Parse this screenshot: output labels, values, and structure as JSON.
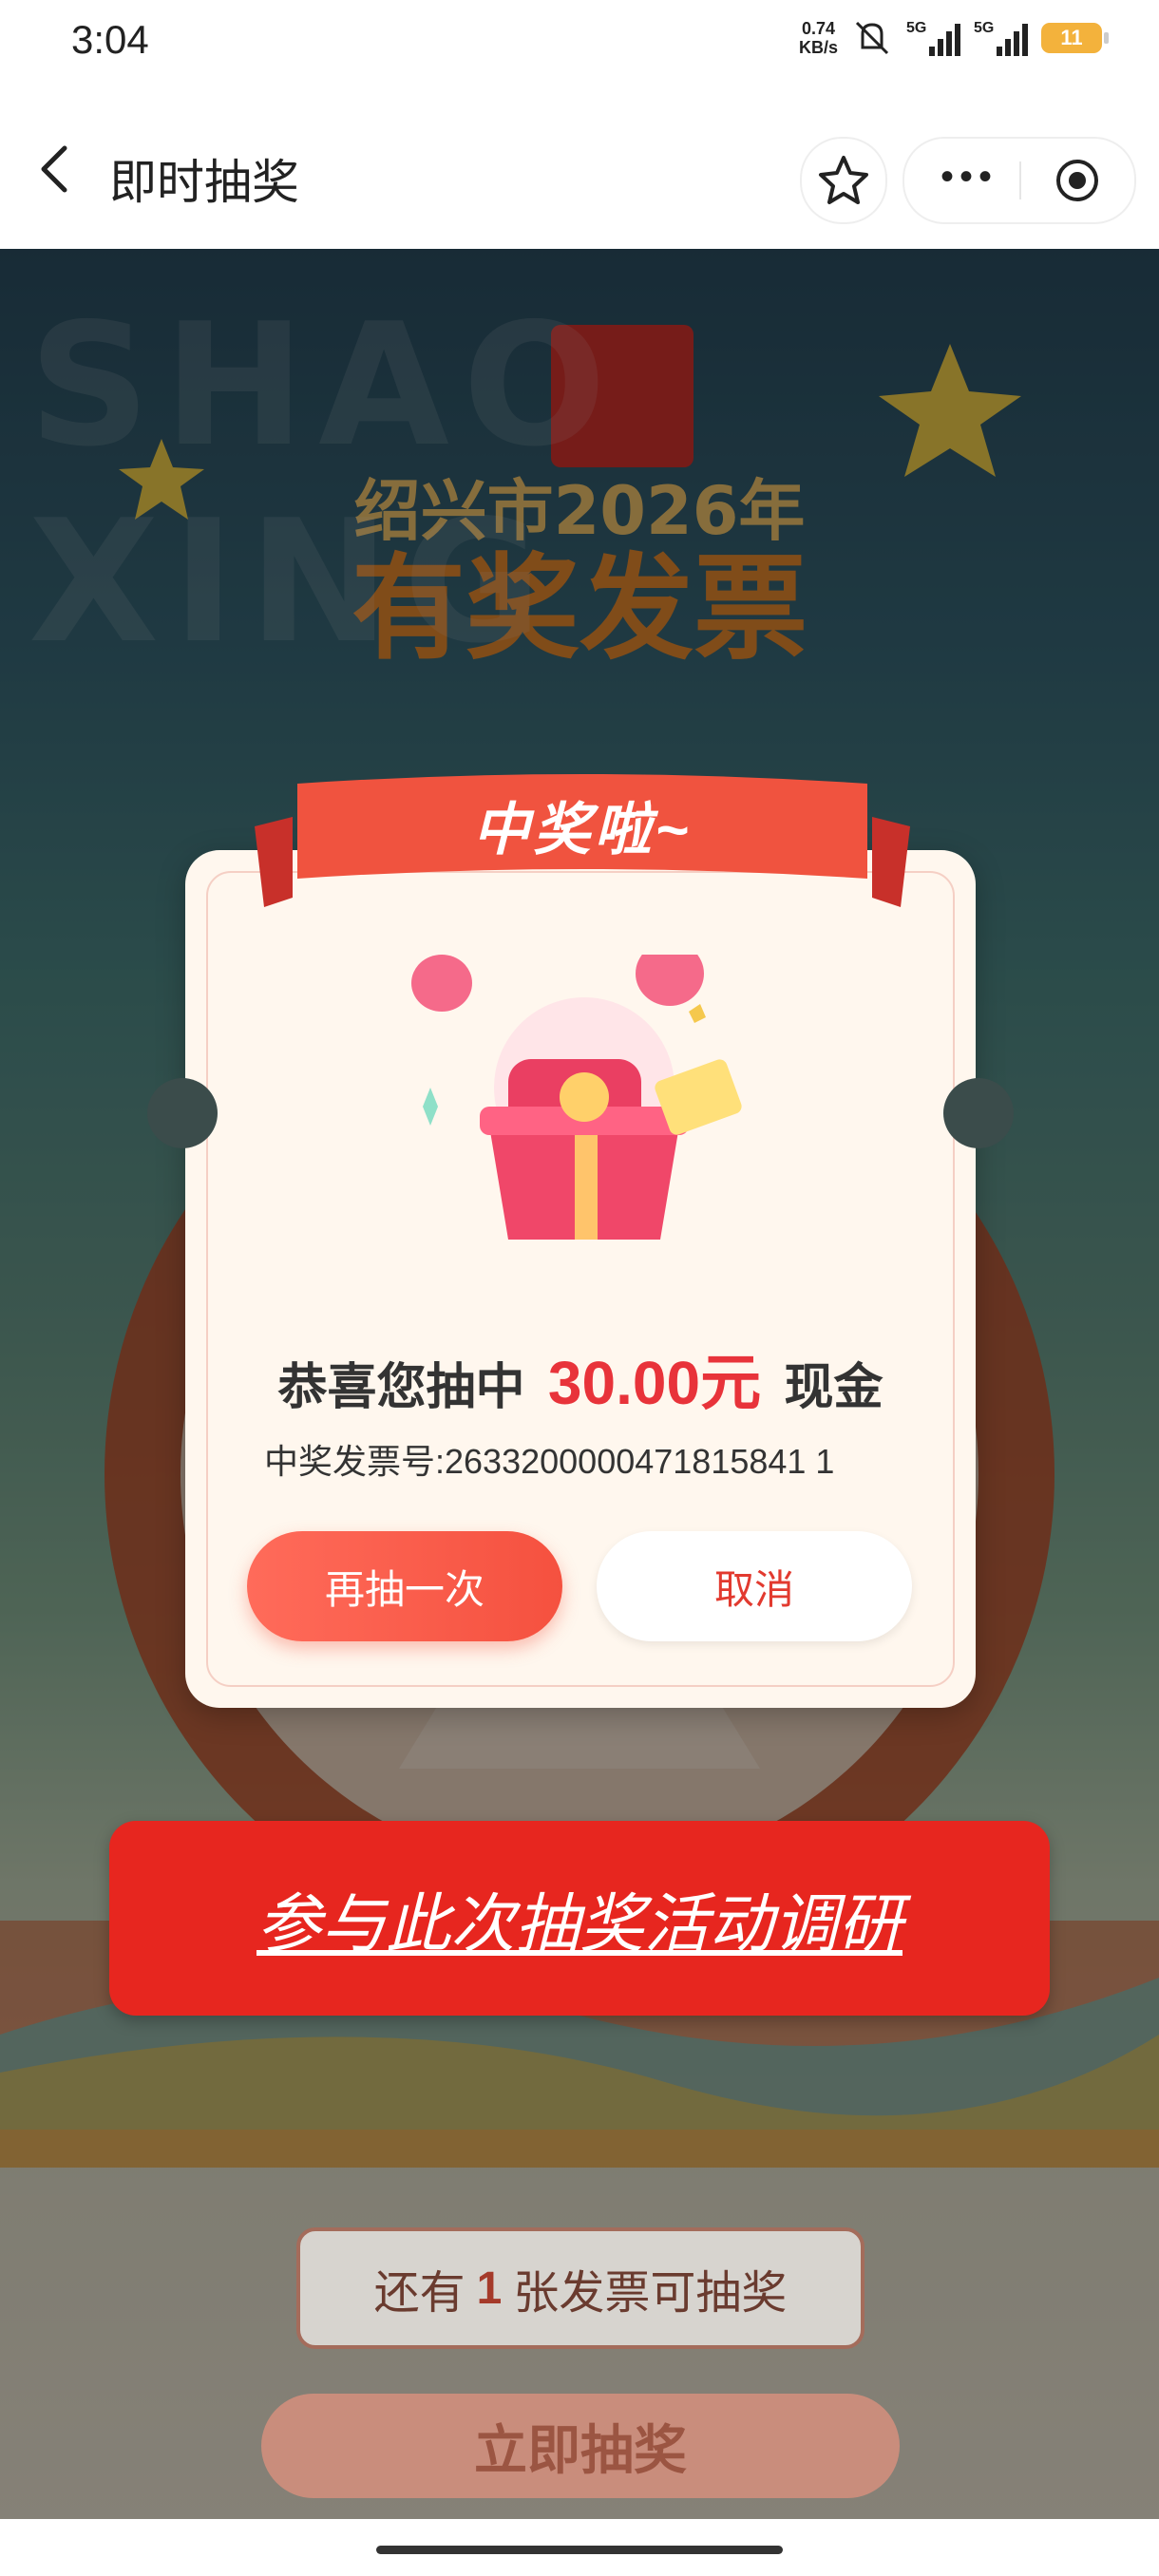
{
  "status_bar": {
    "time": "3:04",
    "net_speed": "0.74",
    "net_unit": "KB/s",
    "sim1": "5G",
    "sim2": "5G",
    "battery": "11"
  },
  "nav": {
    "title": "即时抽奖"
  },
  "background": {
    "watermark": "SHAO XING"
  },
  "popup": {
    "ribbon": "中奖啦~",
    "congrats_prefix": "恭喜您抽中",
    "amount": "30.00元",
    "congrats_suffix": "现金",
    "invoice_label": "中奖发票号:",
    "invoice_number": "2633200000471815841 1",
    "btn_again": "再抽一次",
    "btn_cancel": "取消"
  },
  "survey_button": "参与此次抽奖活动调研",
  "remaining": {
    "prefix": "还有",
    "count": "1",
    "suffix": "张发票可抽奖"
  },
  "draw_button": "立即抽奖"
}
